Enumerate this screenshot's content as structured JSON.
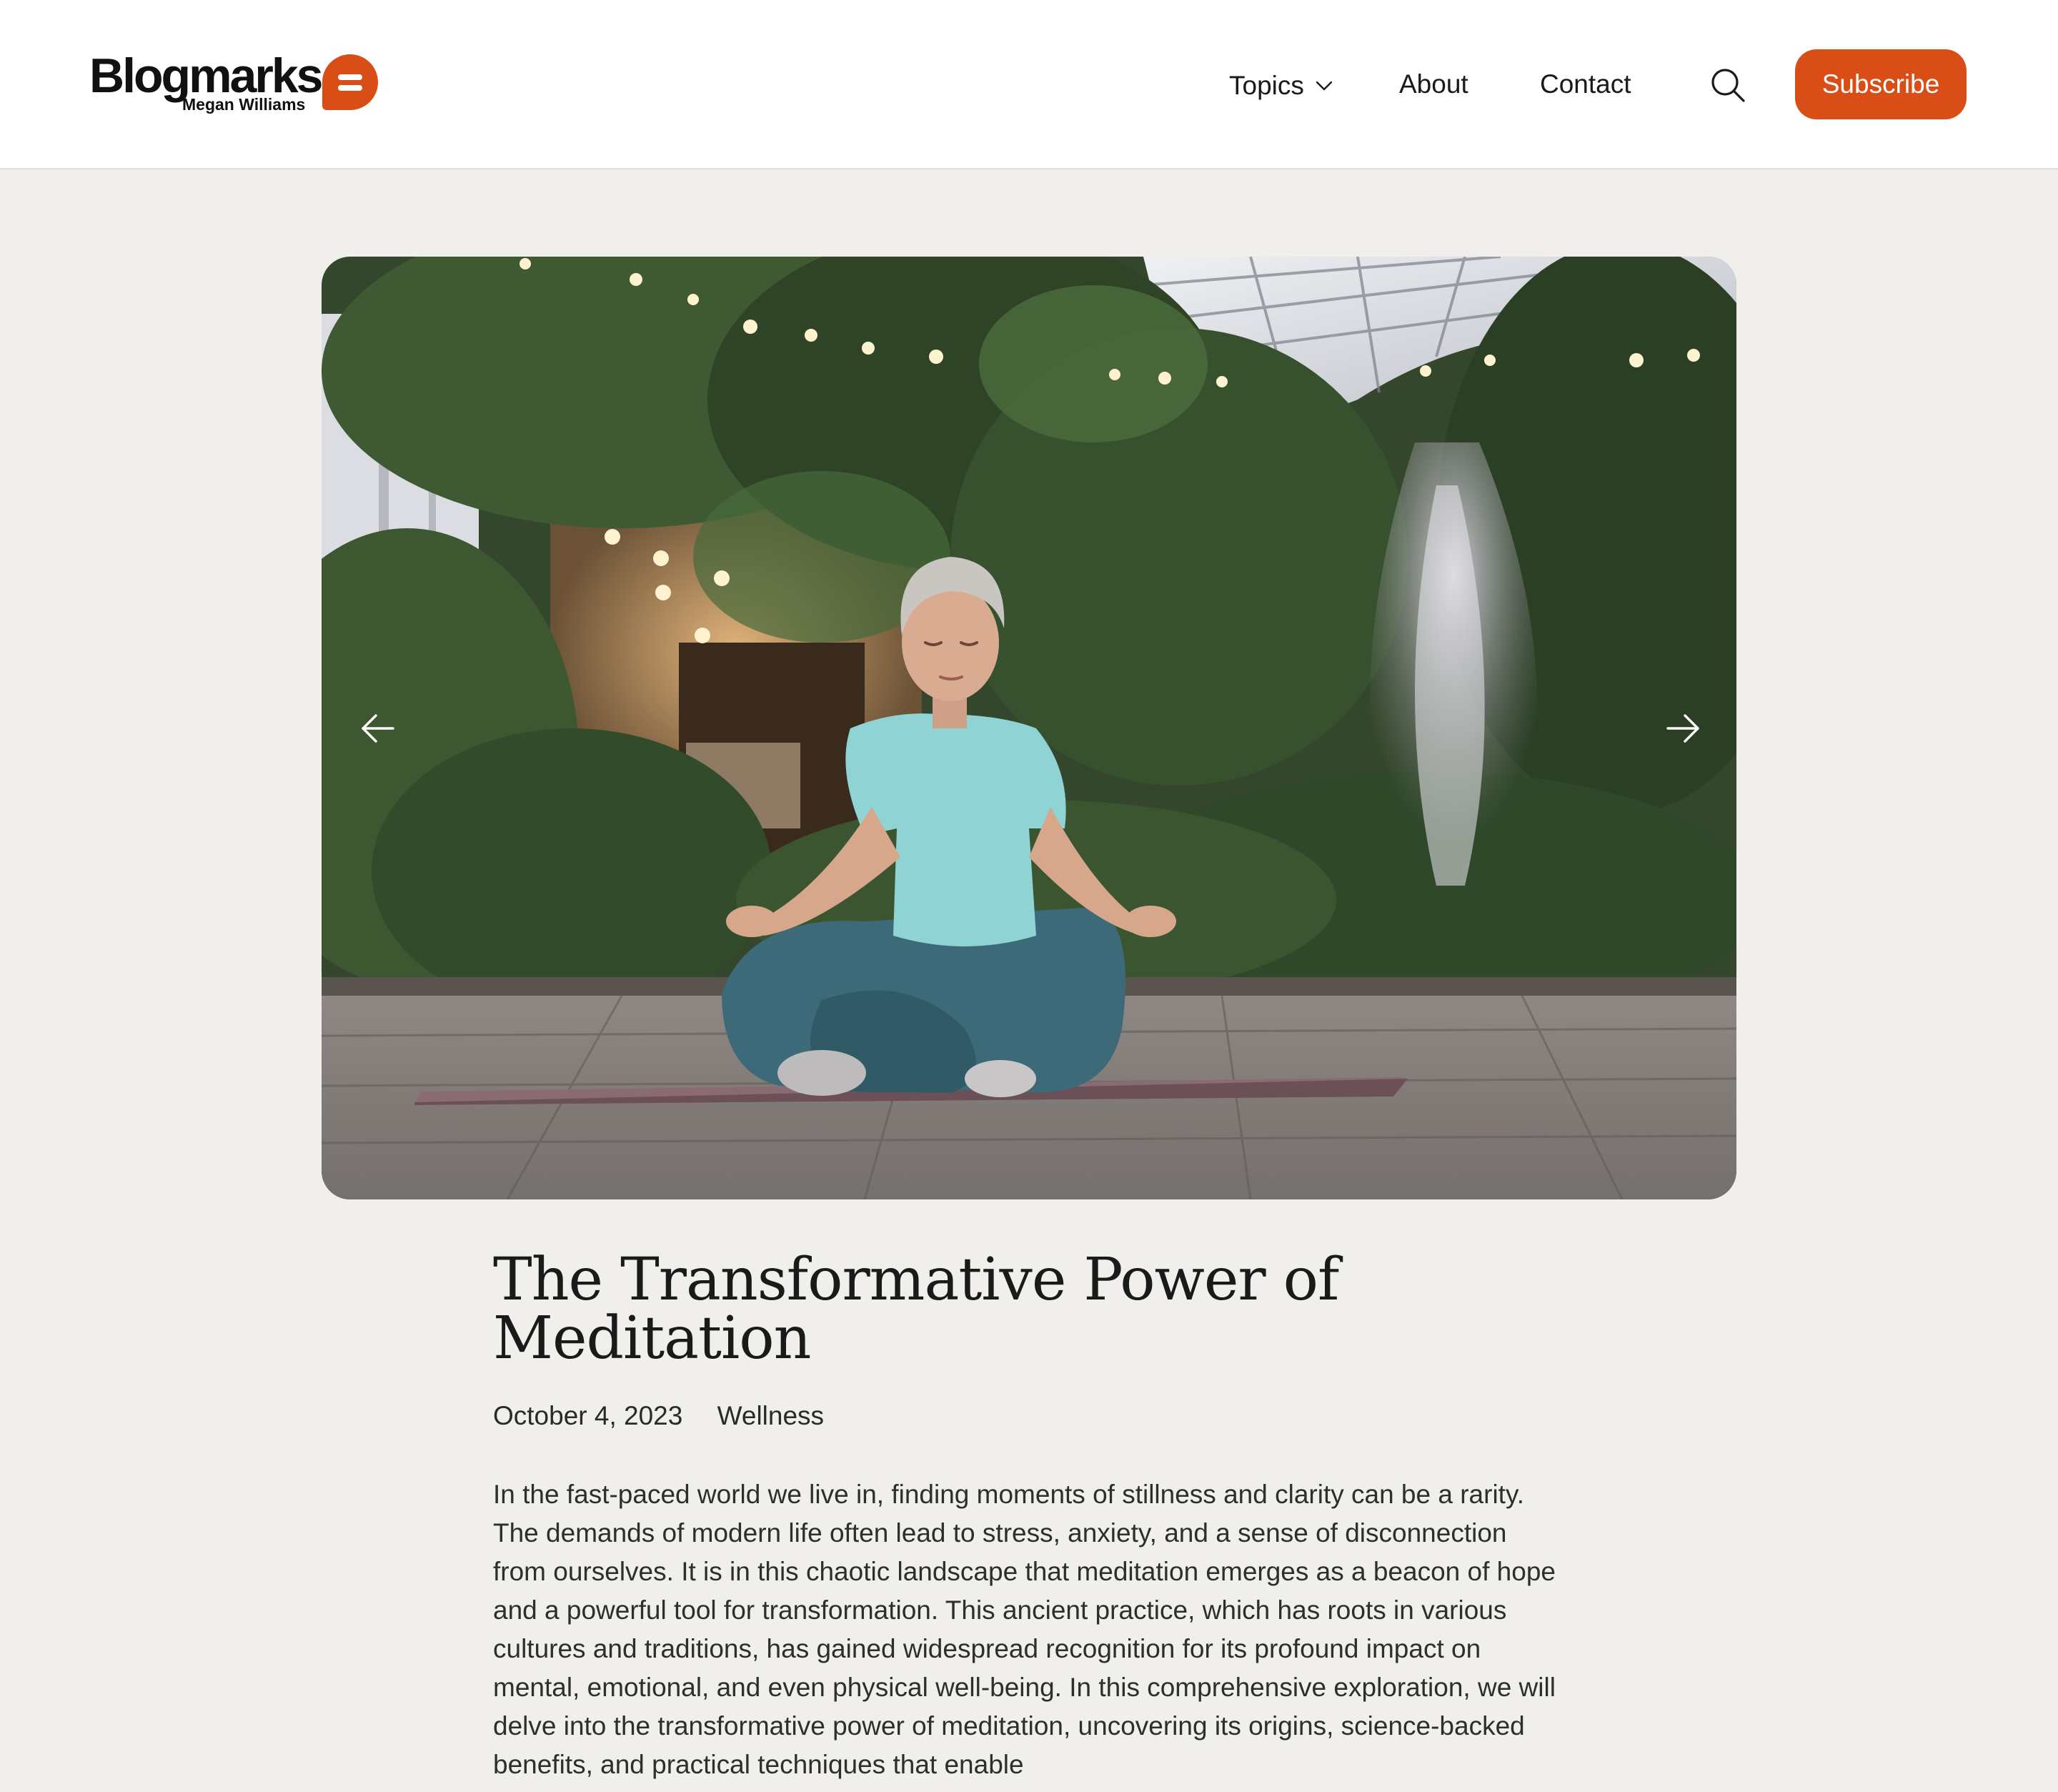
{
  "brand": {
    "name": "Blogmarks",
    "author": "Megan Williams",
    "accent_color": "#d94d16"
  },
  "nav": {
    "items": [
      {
        "label": "Topics",
        "has_dropdown": true
      },
      {
        "label": "About"
      },
      {
        "label": "Contact"
      }
    ],
    "search_icon": "search-icon",
    "subscribe_label": "Subscribe"
  },
  "hero": {
    "image_subject": "woman meditating cross-legged on a mat in a greenhouse garden with a fountain",
    "prev_icon": "arrow-left-icon",
    "next_icon": "arrow-right-icon"
  },
  "article": {
    "title": "The Transformative Power of Meditation",
    "date": "October 4, 2023",
    "category": "Wellness",
    "body": "In the fast-paced world we live in, finding moments of stillness and clarity can be a rarity. The demands of modern life often lead to stress, anxiety, and a sense of disconnection from ourselves. It is in this chaotic landscape that meditation emerges as a beacon of hope and a powerful tool for transformation. This ancient practice, which has roots in various cultures and traditions, has gained widespread recognition for its profound impact on mental, emotional, and even physical well-being. In this comprehensive exploration, we will delve into the transformative power of meditation, uncovering its origins, science-backed benefits, and practical techniques that enable"
  }
}
